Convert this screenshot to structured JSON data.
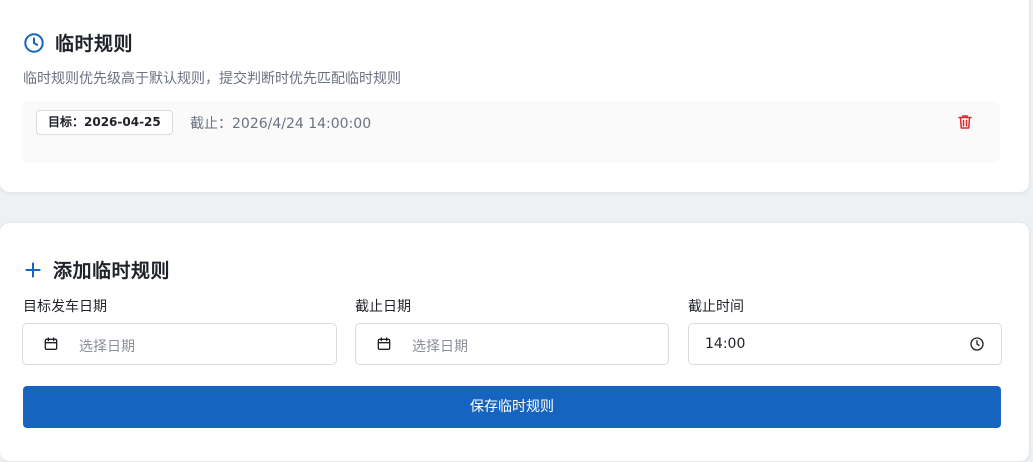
{
  "temp_rules": {
    "title": "临时规则",
    "subtitle": "临时规则优先级高于默认规则，提交判断时优先匹配临时规则",
    "rules": [
      {
        "target_label": "目标：2026-04-25",
        "deadline_label": "截止：2026/4/24 14:00:00"
      }
    ],
    "delete_icon": "trash-icon"
  },
  "add_rule": {
    "title": "添加临时规则",
    "fields": {
      "target_date": {
        "label": "目标发车日期",
        "placeholder": "选择日期"
      },
      "deadline_date": {
        "label": "截止日期",
        "placeholder": "选择日期"
      },
      "deadline_time": {
        "label": "截止时间",
        "value": "14:00"
      }
    },
    "save_label": "保存临时规则"
  },
  "colors": {
    "accent": "#1565c0",
    "danger": "#d32f2f",
    "muted_text": "#6b7280"
  }
}
